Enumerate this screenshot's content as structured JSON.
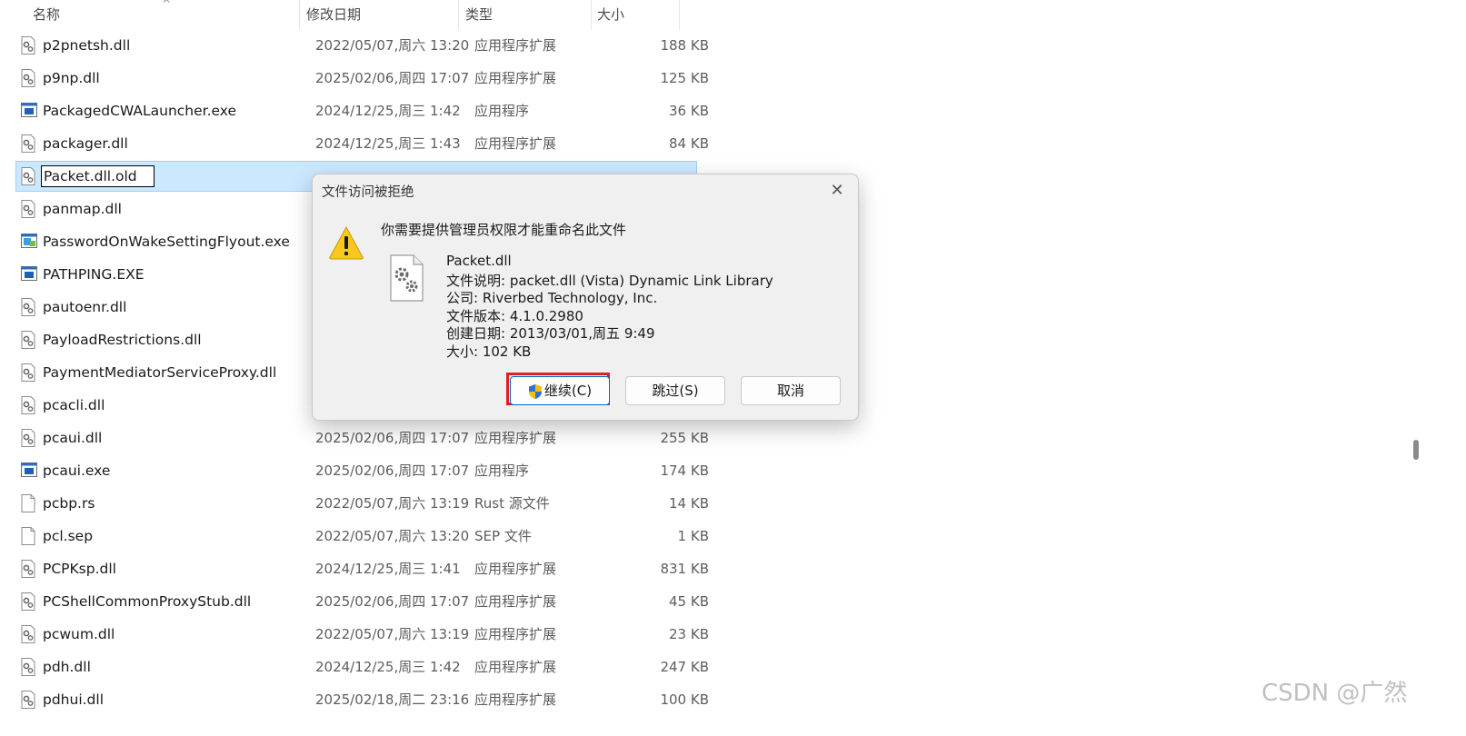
{
  "columns": {
    "name": "名称",
    "date": "修改日期",
    "type": "类型",
    "size": "大小"
  },
  "files": [
    {
      "name": "p2pnetsh.dll",
      "date": "2022/05/07,周六 13:20",
      "type": "应用程序扩展",
      "size": "188 KB",
      "icon": "dll-icon"
    },
    {
      "name": "p9np.dll",
      "date": "2025/02/06,周四 17:07",
      "type": "应用程序扩展",
      "size": "125 KB",
      "icon": "dll-icon"
    },
    {
      "name": "PackagedCWALauncher.exe",
      "date": "2024/12/25,周三 1:42",
      "type": "应用程序",
      "size": "36 KB",
      "icon": "exe-icon"
    },
    {
      "name": "packager.dll",
      "date": "2024/12/25,周三 1:43",
      "type": "应用程序扩展",
      "size": "84 KB",
      "icon": "dll-icon"
    },
    {
      "name": "Packet.dll.old",
      "date": "",
      "type": "",
      "size": "",
      "icon": "dll-icon",
      "selected": true
    },
    {
      "name": "panmap.dll",
      "date": "",
      "type": "",
      "size": "",
      "icon": "dll-icon"
    },
    {
      "name": "PasswordOnWakeSettingFlyout.exe",
      "date": "",
      "type": "",
      "size": "",
      "icon": "exe-color-icon"
    },
    {
      "name": "PATHPING.EXE",
      "date": "",
      "type": "",
      "size": "",
      "icon": "exe-icon"
    },
    {
      "name": "pautoenr.dll",
      "date": "",
      "type": "",
      "size": "",
      "icon": "dll-icon"
    },
    {
      "name": "PayloadRestrictions.dll",
      "date": "",
      "type": "",
      "size": "",
      "icon": "dll-icon"
    },
    {
      "name": "PaymentMediatorServiceProxy.dll",
      "date": "",
      "type": "",
      "size": "",
      "icon": "dll-icon"
    },
    {
      "name": "pcacli.dll",
      "date": "",
      "type": "",
      "size": "",
      "icon": "dll-icon"
    },
    {
      "name": "pcaui.dll",
      "date": "2025/02/06,周四 17:07",
      "type": "应用程序扩展",
      "size": "255 KB",
      "icon": "dll-icon"
    },
    {
      "name": "pcaui.exe",
      "date": "2025/02/06,周四 17:07",
      "type": "应用程序",
      "size": "174 KB",
      "icon": "exe-icon"
    },
    {
      "name": "pcbp.rs",
      "date": "2022/05/07,周六 13:19",
      "type": "Rust 源文件",
      "size": "14 KB",
      "icon": "file-icon"
    },
    {
      "name": "pcl.sep",
      "date": "2022/05/07,周六 13:20",
      "type": "SEP 文件",
      "size": "1 KB",
      "icon": "file-icon"
    },
    {
      "name": "PCPKsp.dll",
      "date": "2024/12/25,周三 1:41",
      "type": "应用程序扩展",
      "size": "831 KB",
      "icon": "dll-icon"
    },
    {
      "name": "PCShellCommonProxyStub.dll",
      "date": "2025/02/06,周四 17:07",
      "type": "应用程序扩展",
      "size": "45 KB",
      "icon": "dll-icon"
    },
    {
      "name": "pcwum.dll",
      "date": "2022/05/07,周六 13:19",
      "type": "应用程序扩展",
      "size": "23 KB",
      "icon": "dll-icon"
    },
    {
      "name": "pdh.dll",
      "date": "2024/12/25,周三 1:42",
      "type": "应用程序扩展",
      "size": "247 KB",
      "icon": "dll-icon"
    },
    {
      "name": "pdhui.dll",
      "date": "2025/02/18,周二 23:16",
      "type": "应用程序扩展",
      "size": "100 KB",
      "icon": "dll-icon"
    }
  ],
  "dialog": {
    "title": "文件访问被拒绝",
    "close": "✕",
    "message": "你需要提供管理员权限才能重命名此文件",
    "file_name": "Packet.dll",
    "description": "文件说明: packet.dll (Vista) Dynamic Link Library",
    "company": "公司: Riverbed Technology, Inc.",
    "version": "文件版本: 4.1.0.2980",
    "created": "创建日期: 2013/03/01,周五 9:49",
    "size": "大小: 102 KB",
    "continue_label": "继续(C)",
    "skip_label": "跳过(S)",
    "cancel_label": "取消"
  },
  "watermark": "CSDN @广然",
  "colors": {
    "selection": "#cce8ff",
    "highlight_border": "#e02020",
    "primary_border": "#0067c0"
  }
}
